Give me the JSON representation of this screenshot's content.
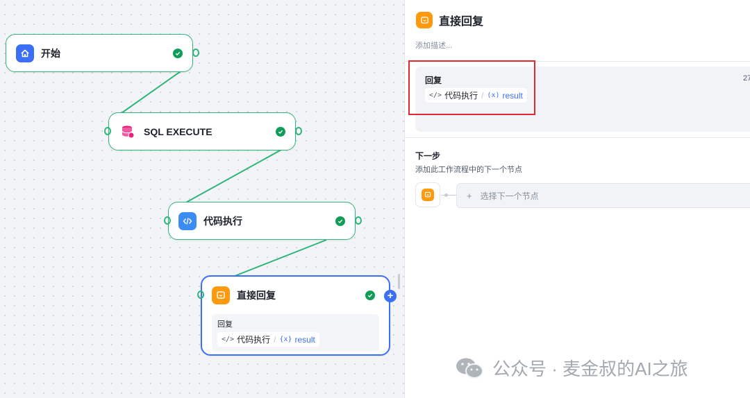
{
  "canvas": {
    "nodes": [
      {
        "id": "start",
        "title": "开始",
        "icon": "home-icon",
        "color": "#3b6ff5"
      },
      {
        "id": "sql",
        "title": "SQL EXECUTE",
        "icon": "database-icon",
        "color": "#e6227a"
      },
      {
        "id": "code",
        "title": "代码执行",
        "icon": "code-icon",
        "color": "#3b8cf5"
      },
      {
        "id": "reply",
        "title": "直接回复",
        "icon": "reply-icon",
        "color": "#ff9a0f",
        "reply_label": "回复",
        "ref_source": "代码执行",
        "ref_var_symbol": "{x}",
        "ref_var": "result"
      }
    ],
    "edge_color": "#2fb57a",
    "selected_border_color": "#3b6ff5"
  },
  "panel": {
    "title": "直接回复",
    "description_placeholder": "添加描述...",
    "reply_label": "回复",
    "reply_count": "27",
    "ref_source": "代码执行",
    "ref_var_symbol": "(x)",
    "ref_var": "result",
    "next_title": "下一步",
    "next_description": "添加此工作流程中的下一个节点",
    "select_next_label": "选择下一个节点",
    "select_next_plus": "+",
    "highlight_color": "#e0282e"
  },
  "watermark": {
    "text": "公众号 · 麦金叔的AI之旅"
  }
}
